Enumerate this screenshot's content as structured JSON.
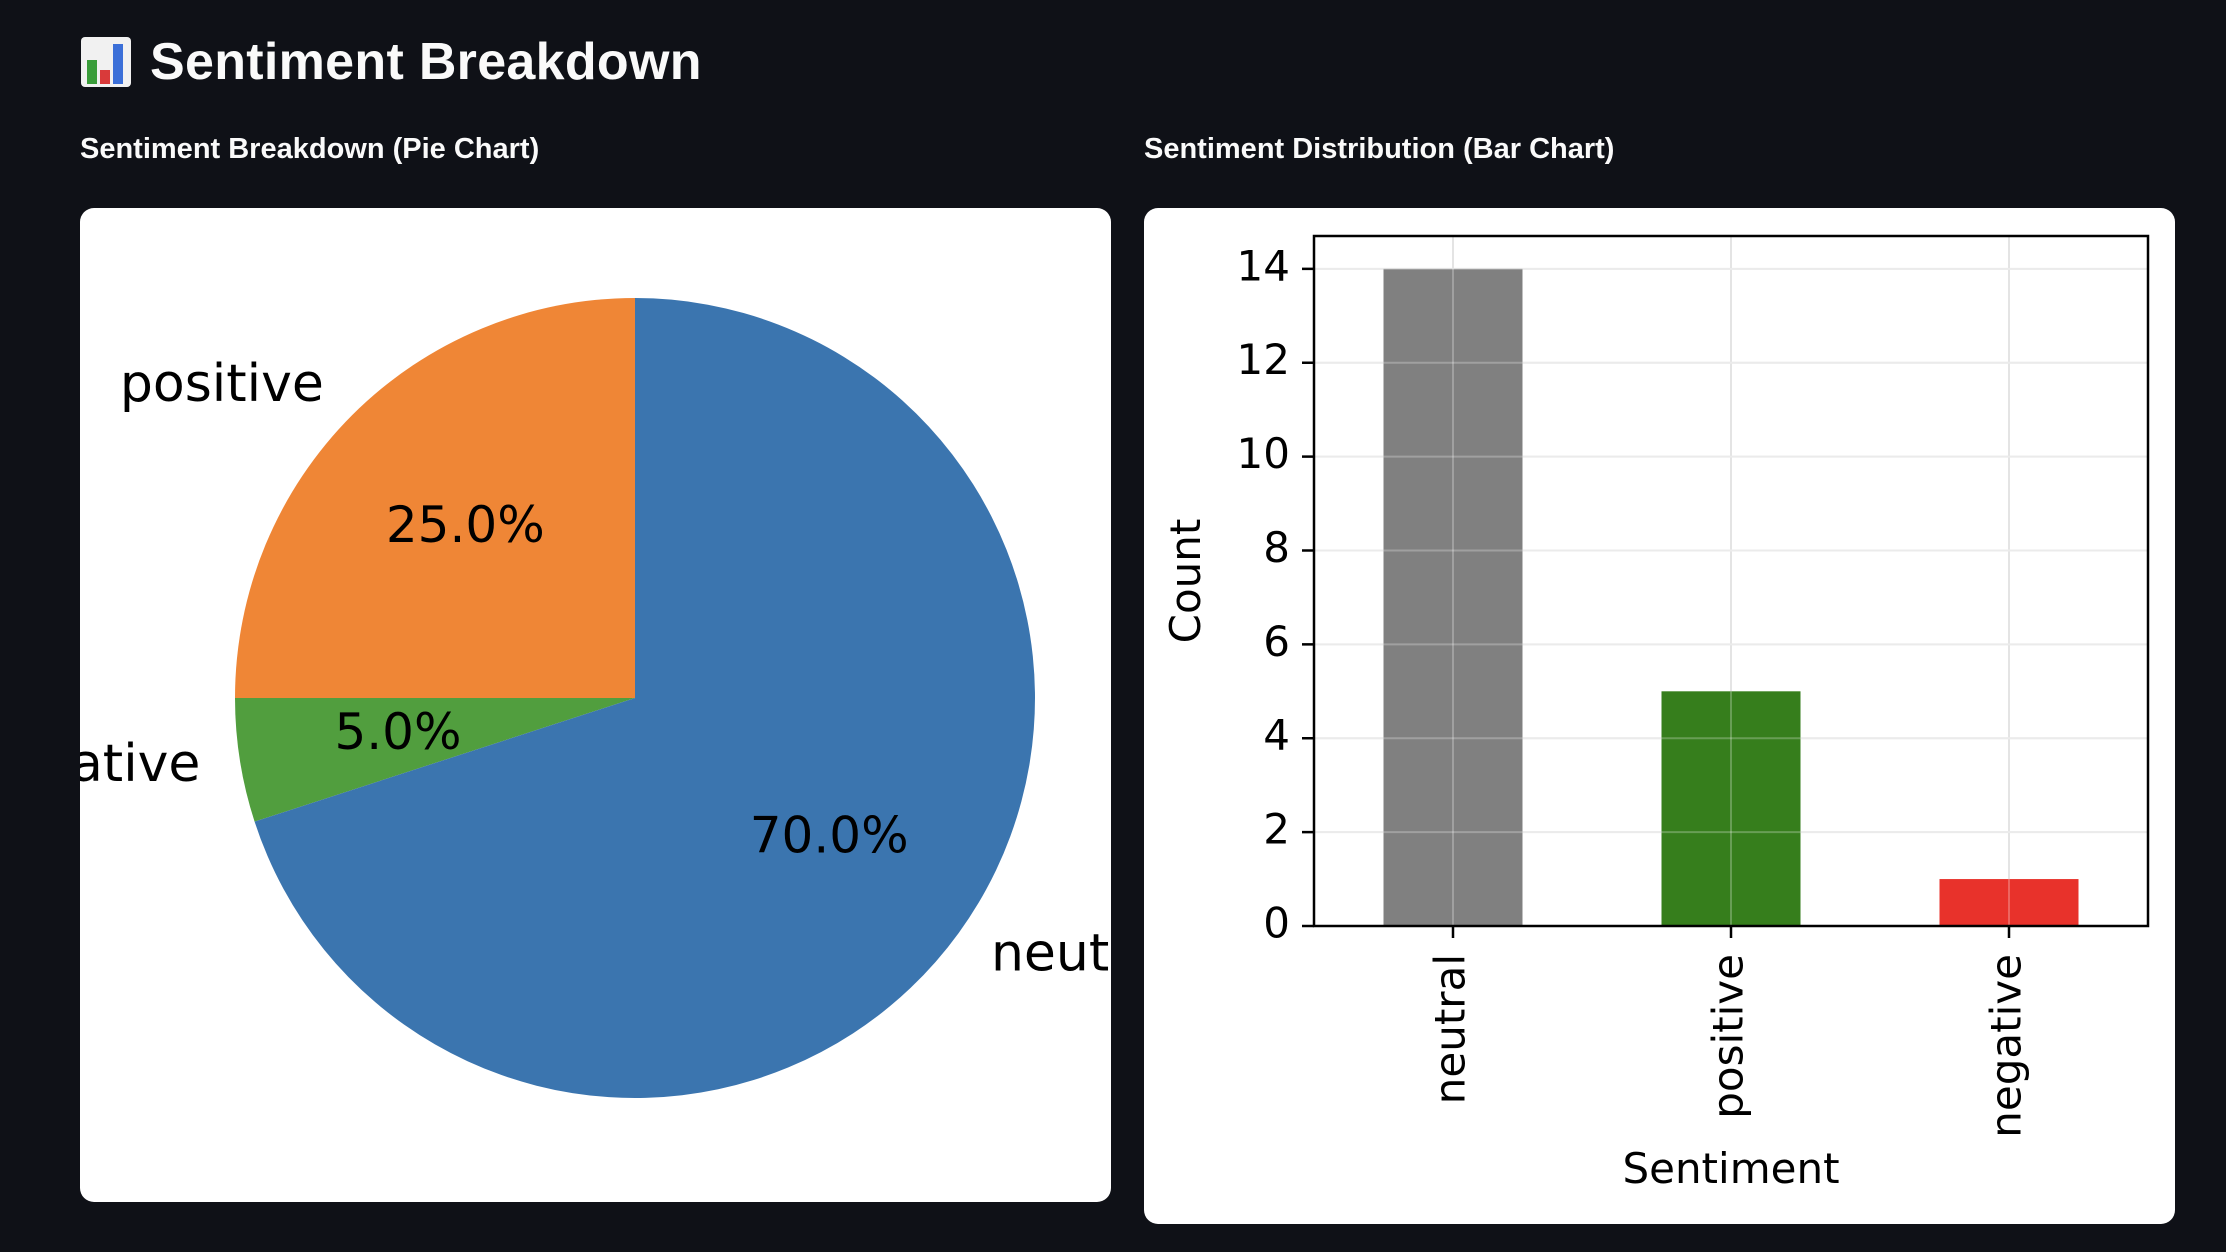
{
  "page": {
    "title": "Sentiment Breakdown",
    "title_icon": "bar-chart-icon"
  },
  "pie_panel": {
    "subheader": "Sentiment Breakdown (Pie Chart)"
  },
  "bar_panel": {
    "subheader": "Sentiment Distribution (Bar Chart)"
  },
  "chart_data": [
    {
      "type": "pie",
      "labels": [
        "positive",
        "negative",
        "neutral"
      ],
      "values": [
        25.0,
        5.0,
        70.0
      ],
      "pct_labels": [
        "25.0%",
        "5.0%",
        "70.0%"
      ],
      "colors": [
        "#ef8636",
        "#519e3e",
        "#3b75af"
      ],
      "start_angle_deg": 90,
      "direction": "counterclockwise"
    },
    {
      "type": "bar",
      "categories": [
        "neutral",
        "positive",
        "negative"
      ],
      "values": [
        14,
        5,
        1
      ],
      "colors": [
        "#808080",
        "#367e1c",
        "#e8322b"
      ],
      "xlabel": "Sentiment",
      "ylabel": "Count",
      "ylim": [
        0,
        14.7
      ],
      "yticks": [
        0,
        2,
        4,
        6,
        8,
        10,
        12,
        14
      ],
      "grid": true
    }
  ]
}
